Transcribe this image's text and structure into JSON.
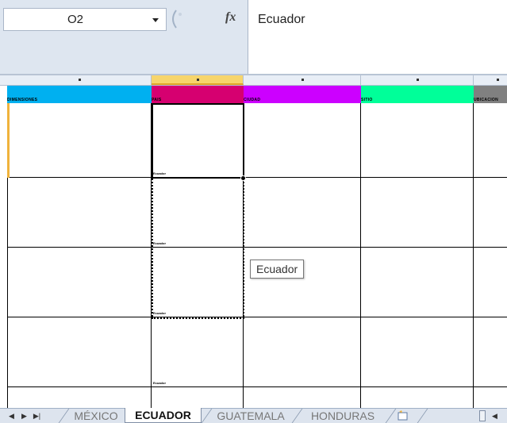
{
  "formula_bar": {
    "name_box": "O2",
    "fx_label": "fx",
    "formula": "Ecuador"
  },
  "sheet": {
    "selected_column_index": 1,
    "headers": [
      "DIMENSIONES",
      "PAIS",
      "CIUDAD",
      "SITIO",
      "UBICACION"
    ],
    "header_colors": [
      "#00b0f0",
      "#d60070",
      "#cc00ff",
      "#00ff99",
      "#808080"
    ],
    "rows": [
      [
        "",
        "Ecuador",
        "",
        "",
        ""
      ],
      [
        "",
        "Ecuador",
        "",
        "",
        ""
      ],
      [
        "",
        "Ecuador",
        "",
        "",
        ""
      ],
      [
        "",
        "Ecuador",
        "",
        "",
        ""
      ],
      [
        "",
        "",
        "",
        "",
        ""
      ]
    ]
  },
  "tooltip": "Ecuador",
  "tabs": {
    "nav_icons": [
      "first-sheet-icon",
      "prev-sheet-icon",
      "next-sheet-icon"
    ],
    "items": [
      {
        "label": "MÉXICO",
        "active": false
      },
      {
        "label": "ECUADOR",
        "active": true
      },
      {
        "label": "GUATEMALA",
        "active": false
      },
      {
        "label": "HONDURAS",
        "active": false
      }
    ]
  }
}
